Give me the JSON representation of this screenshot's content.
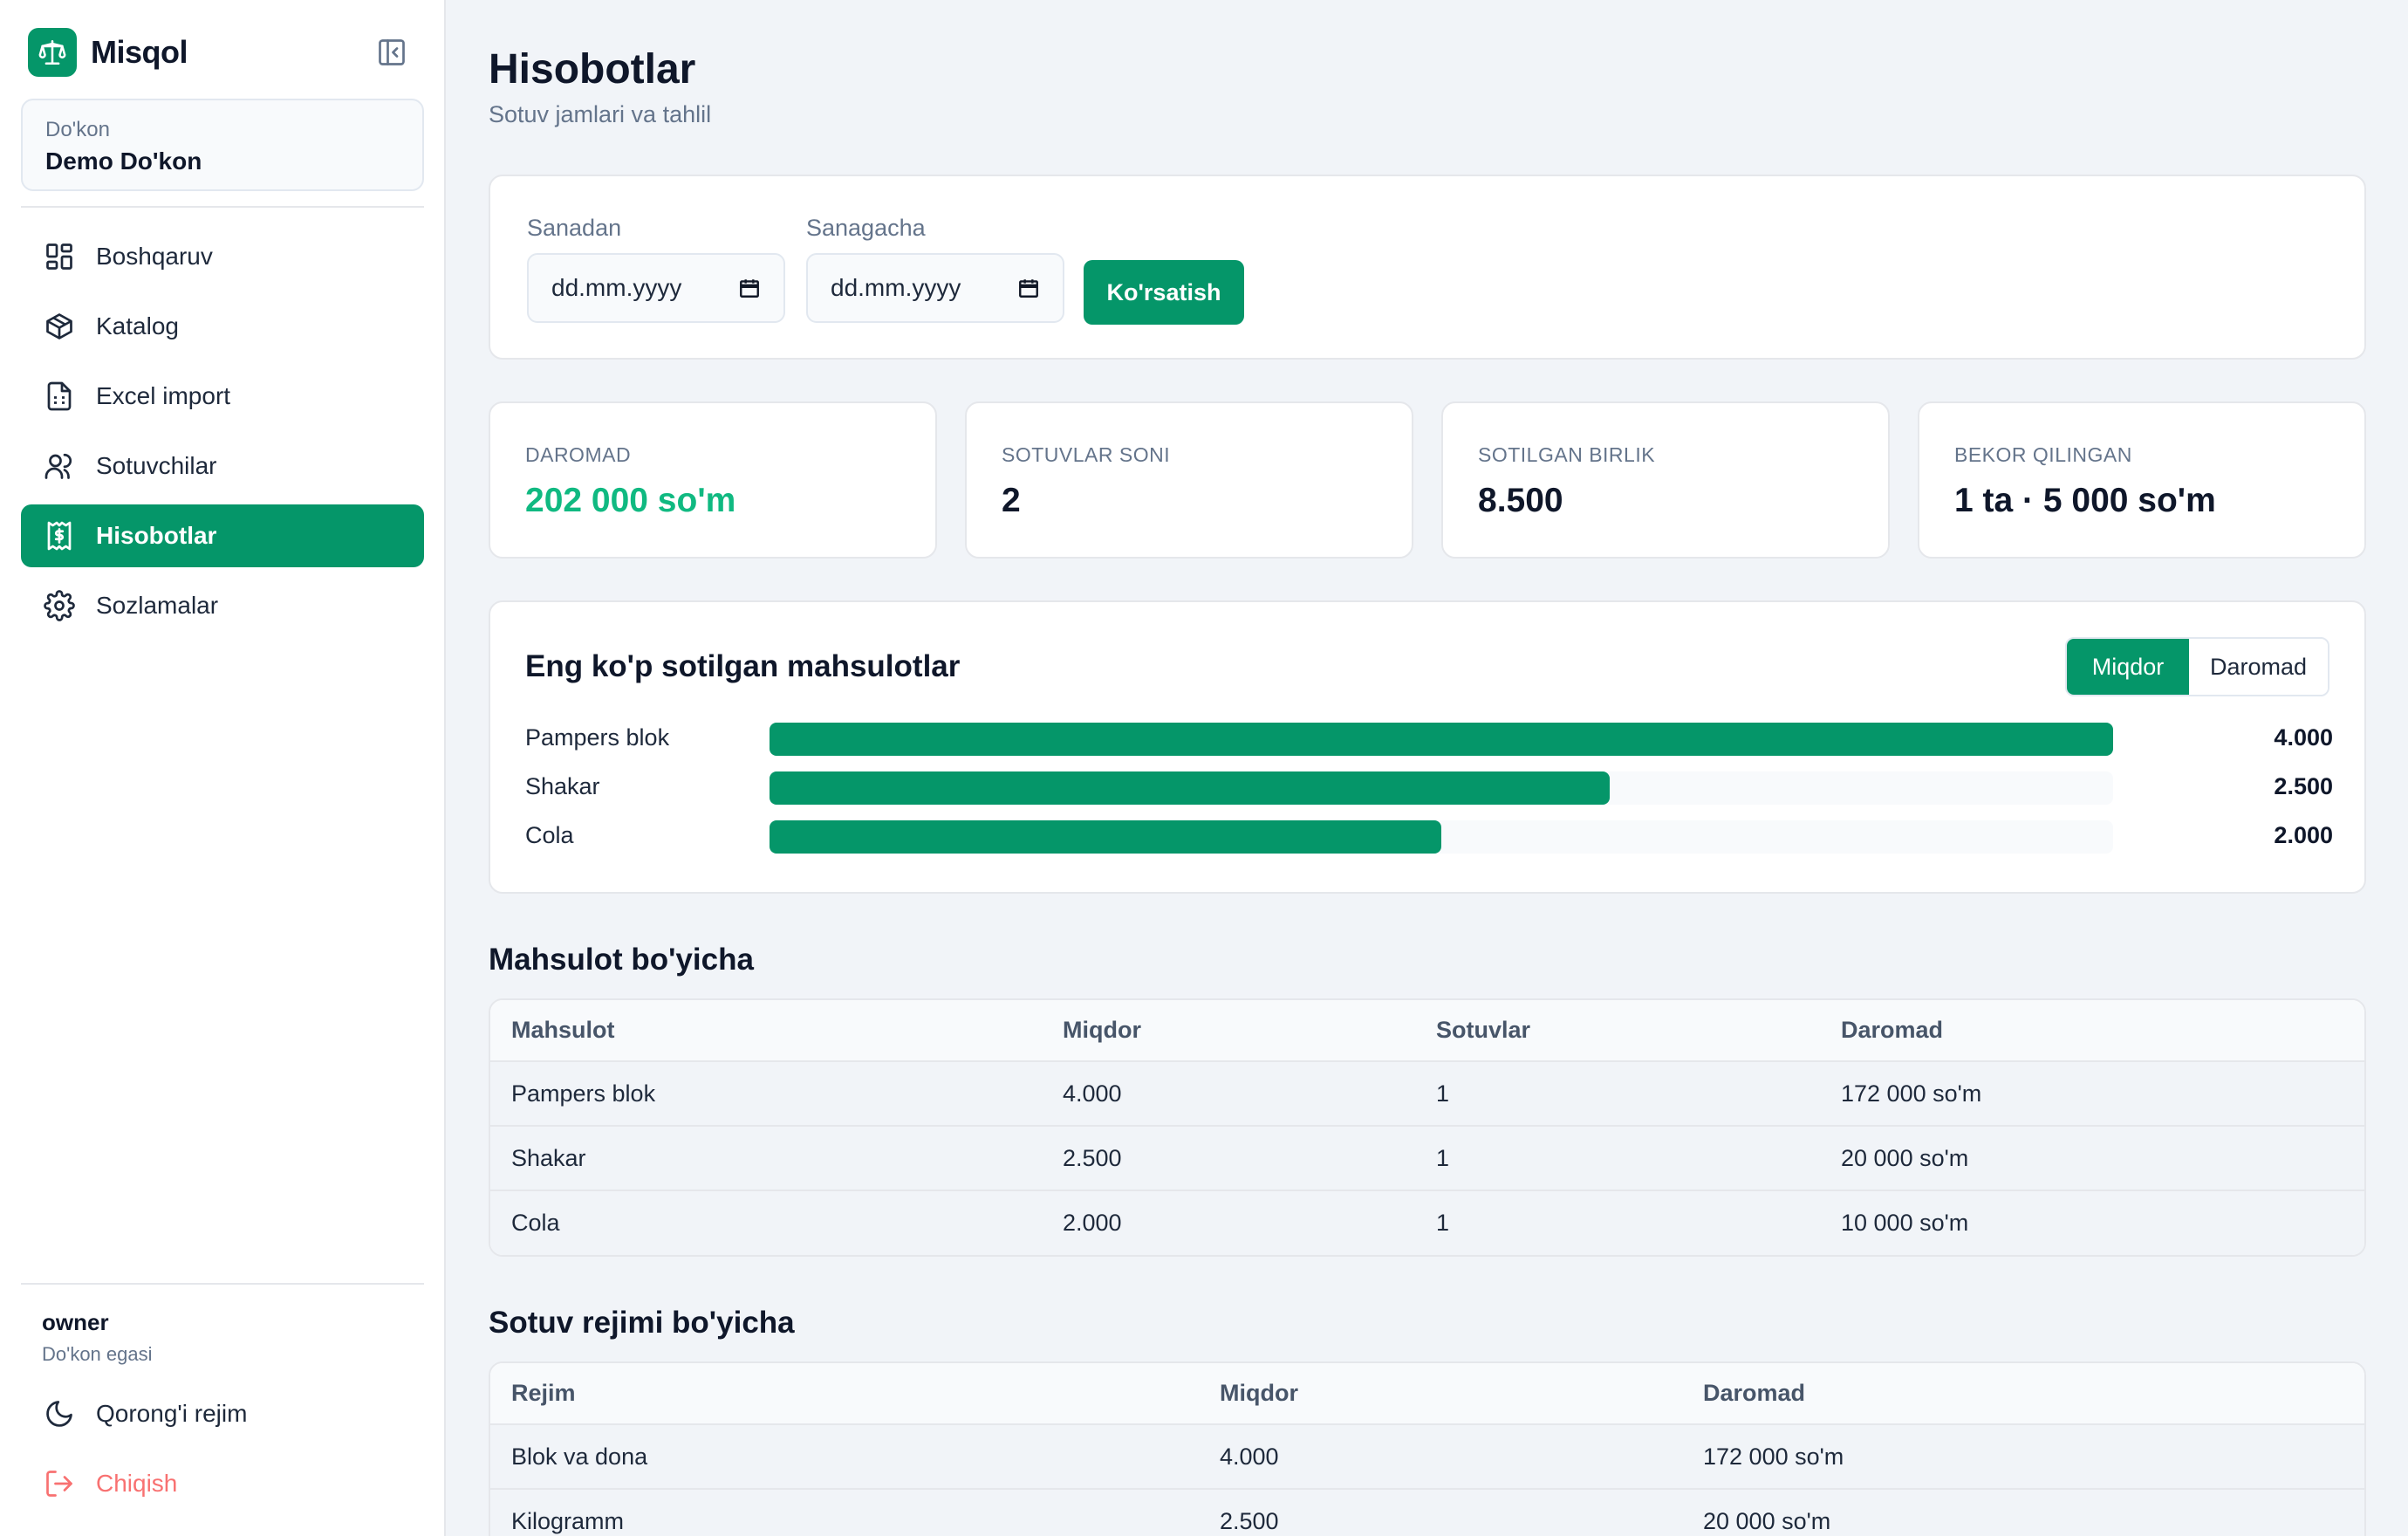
{
  "app": {
    "name": "Misqol"
  },
  "store": {
    "label": "Do'kon",
    "name": "Demo Do'kon"
  },
  "nav": [
    {
      "label": "Boshqaruv",
      "icon": "dashboard-icon"
    },
    {
      "label": "Katalog",
      "icon": "package-icon"
    },
    {
      "label": "Excel import",
      "icon": "file-spreadsheet-icon"
    },
    {
      "label": "Sotuvchilar",
      "icon": "users-icon"
    },
    {
      "label": "Hisobotlar",
      "icon": "receipt-icon",
      "active": true
    },
    {
      "label": "Sozlamalar",
      "icon": "gear-icon"
    }
  ],
  "user": {
    "name": "owner",
    "role": "Do'kon egasi"
  },
  "bottom_nav": [
    {
      "label": "Qorong'i rejim",
      "icon": "moon-icon"
    },
    {
      "label": "Chiqish",
      "icon": "logout-icon"
    }
  ],
  "page": {
    "title": "Hisobotlar",
    "subtitle": "Sotuv jamlari va tahlil"
  },
  "filters": {
    "from_label": "Sanadan",
    "from_placeholder": "dd.mm.yyyy",
    "to_label": "Sanagacha",
    "to_placeholder": "dd.mm.yyyy",
    "submit_label": "Ko'rsatish"
  },
  "stats": [
    {
      "label": "DAROMAD",
      "value": "202 000 so'm"
    },
    {
      "label": "SOTUVLAR SONI",
      "value": "2"
    },
    {
      "label": "SOTILGAN BIRLIK",
      "value": "8.500"
    },
    {
      "label": "BEKOR QILINGAN",
      "value": "1 ta · 5 000 so'm"
    }
  ],
  "top_products": {
    "title": "Eng ko'p sotilgan mahsulotlar",
    "toggle": {
      "quantity": "Miqdor",
      "revenue": "Daromad"
    },
    "max": 4000
  },
  "chart_data": {
    "type": "bar",
    "orientation": "horizontal",
    "title": "Eng ko'p sotilgan mahsulotlar",
    "categories": [
      "Pampers blok",
      "Shakar",
      "Cola"
    ],
    "values": [
      4000,
      2500,
      2000
    ],
    "value_labels": [
      "4.000",
      "2.500",
      "2.000"
    ],
    "xlim": [
      0,
      4000
    ],
    "bar_color": "#059669"
  },
  "product_table": {
    "title": "Mahsulot bo'yicha",
    "columns": [
      "Mahsulot",
      "Miqdor",
      "Sotuvlar",
      "Daromad"
    ],
    "rows": [
      [
        "Pampers blok",
        "4.000",
        "1",
        "172 000 so'm"
      ],
      [
        "Shakar",
        "2.500",
        "1",
        "20 000 so'm"
      ],
      [
        "Cola",
        "2.000",
        "1",
        "10 000 so'm"
      ]
    ]
  },
  "mode_table": {
    "title": "Sotuv rejimi bo'yicha",
    "columns": [
      "Rejim",
      "Miqdor",
      "Daromad"
    ],
    "rows": [
      [
        "Blok va dona",
        "4.000",
        "172 000 so'm"
      ],
      [
        "Kilogramm",
        "2.500",
        "20 000 so'm"
      ]
    ]
  },
  "colors": {
    "accent": "#059669",
    "revenue": "#10b981",
    "danger": "#f87171"
  }
}
